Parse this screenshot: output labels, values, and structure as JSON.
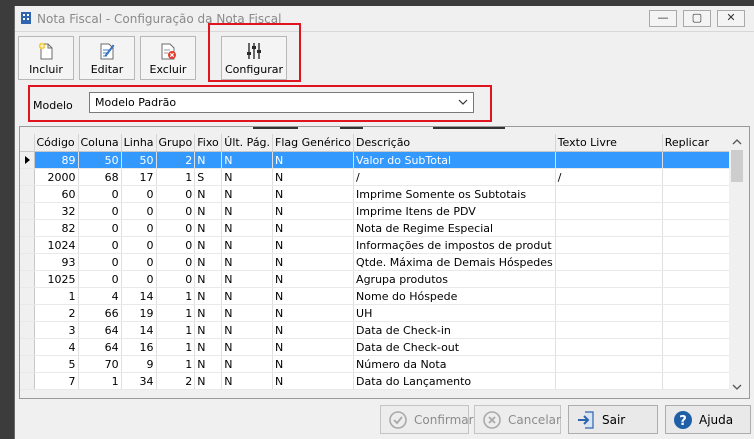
{
  "window": {
    "title": "Nota Fiscal - Configuração da Nota Fiscal",
    "controls": {
      "minimize": "—",
      "maximize": "▢",
      "close": "✕"
    }
  },
  "toolbar": {
    "buttons": [
      {
        "label": "Incluir",
        "icon": "new-document-icon"
      },
      {
        "label": "Editar",
        "icon": "edit-document-icon"
      },
      {
        "label": "Excluir",
        "icon": "delete-document-icon"
      },
      {
        "label": "Configurar",
        "icon": "sliders-icon"
      }
    ]
  },
  "model": {
    "label": "Modelo",
    "selected": "Modelo Padrão"
  },
  "grid": {
    "columns": [
      "Código",
      "Coluna",
      "Linha",
      "Grupo",
      "Fixo",
      "Últ. Pág.",
      "Flag Genérico",
      "Descrição",
      "Texto Livre",
      "Replicar"
    ],
    "rows": [
      {
        "codigo": "89",
        "coluna": "50",
        "linha": "50",
        "grupo": "2",
        "fixo": "N",
        "ult_pag": "N",
        "flag": "N",
        "descricao": "Valor do SubTotal",
        "texto_livre": "",
        "replicar": "",
        "selected": true
      },
      {
        "codigo": "2000",
        "coluna": "68",
        "linha": "17",
        "grupo": "1",
        "fixo": "S",
        "ult_pag": "N",
        "flag": "N",
        "descricao": "/",
        "texto_livre": "/",
        "replicar": ""
      },
      {
        "codigo": "60",
        "coluna": "0",
        "linha": "0",
        "grupo": "0",
        "fixo": "N",
        "ult_pag": "N",
        "flag": "N",
        "descricao": "Imprime Somente os Subtotais",
        "texto_livre": "",
        "replicar": ""
      },
      {
        "codigo": "32",
        "coluna": "0",
        "linha": "0",
        "grupo": "0",
        "fixo": "N",
        "ult_pag": "N",
        "flag": "N",
        "descricao": "Imprime Itens de PDV",
        "texto_livre": "",
        "replicar": ""
      },
      {
        "codigo": "82",
        "coluna": "0",
        "linha": "0",
        "grupo": "0",
        "fixo": "N",
        "ult_pag": "N",
        "flag": "N",
        "descricao": "Nota de Regime Especial",
        "texto_livre": "",
        "replicar": ""
      },
      {
        "codigo": "1024",
        "coluna": "0",
        "linha": "0",
        "grupo": "0",
        "fixo": "N",
        "ult_pag": "N",
        "flag": "N",
        "descricao": "Informações de impostos de produt",
        "texto_livre": "",
        "replicar": ""
      },
      {
        "codigo": "93",
        "coluna": "0",
        "linha": "0",
        "grupo": "0",
        "fixo": "N",
        "ult_pag": "N",
        "flag": "N",
        "descricao": "Qtde. Máxima de Demais Hóspedes",
        "texto_livre": "",
        "replicar": ""
      },
      {
        "codigo": "1025",
        "coluna": "0",
        "linha": "0",
        "grupo": "0",
        "fixo": "N",
        "ult_pag": "N",
        "flag": "N",
        "descricao": "Agrupa produtos",
        "texto_livre": "",
        "replicar": ""
      },
      {
        "codigo": "1",
        "coluna": "4",
        "linha": "14",
        "grupo": "1",
        "fixo": "N",
        "ult_pag": "N",
        "flag": "N",
        "descricao": "Nome do Hóspede",
        "texto_livre": "",
        "replicar": ""
      },
      {
        "codigo": "2",
        "coluna": "66",
        "linha": "19",
        "grupo": "1",
        "fixo": "N",
        "ult_pag": "N",
        "flag": "N",
        "descricao": "UH",
        "texto_livre": "",
        "replicar": ""
      },
      {
        "codigo": "3",
        "coluna": "64",
        "linha": "14",
        "grupo": "1",
        "fixo": "N",
        "ult_pag": "N",
        "flag": "N",
        "descricao": "Data de Check-in",
        "texto_livre": "",
        "replicar": ""
      },
      {
        "codigo": "4",
        "coluna": "64",
        "linha": "16",
        "grupo": "1",
        "fixo": "N",
        "ult_pag": "N",
        "flag": "N",
        "descricao": "Data de Check-out",
        "texto_livre": "",
        "replicar": ""
      },
      {
        "codigo": "5",
        "coluna": "70",
        "linha": "9",
        "grupo": "1",
        "fixo": "N",
        "ult_pag": "N",
        "flag": "N",
        "descricao": "Número da Nota",
        "texto_livre": "",
        "replicar": ""
      },
      {
        "codigo": "7",
        "coluna": "1",
        "linha": "34",
        "grupo": "2",
        "fixo": "N",
        "ult_pag": "N",
        "flag": "N",
        "descricao": "Data do Lançamento",
        "texto_livre": "",
        "replicar": ""
      }
    ]
  },
  "footer": {
    "confirmar": "Confirmar",
    "cancelar": "Cancelar",
    "sair": "Sair",
    "ajuda": "Ajuda"
  },
  "colors": {
    "selection": "#3399ff",
    "highlight_box": "#e0141e",
    "help_icon": "#1f5fa8"
  }
}
